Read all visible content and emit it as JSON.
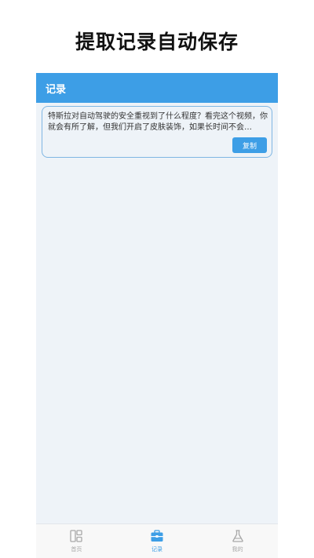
{
  "headline": "提取记录自动保存",
  "appbar": {
    "title": "记录"
  },
  "records": [
    {
      "text": "特斯拉对自动驾驶的安全重视到了什么程度？看完这个视频，你就会有所了解，但我们开启了皮肤装饰，如果长时间不会…",
      "copy_label": "复制"
    }
  ],
  "tabbar": {
    "tabs": [
      {
        "label": "首页",
        "icon": "home-grid-icon",
        "active": false
      },
      {
        "label": "记录",
        "icon": "briefcase-icon",
        "active": true
      },
      {
        "label": "我的",
        "icon": "flask-icon",
        "active": false
      }
    ]
  },
  "colors": {
    "accent": "#3d9ee6",
    "background": "#eef3f8",
    "inactive": "#a8a8a8"
  }
}
